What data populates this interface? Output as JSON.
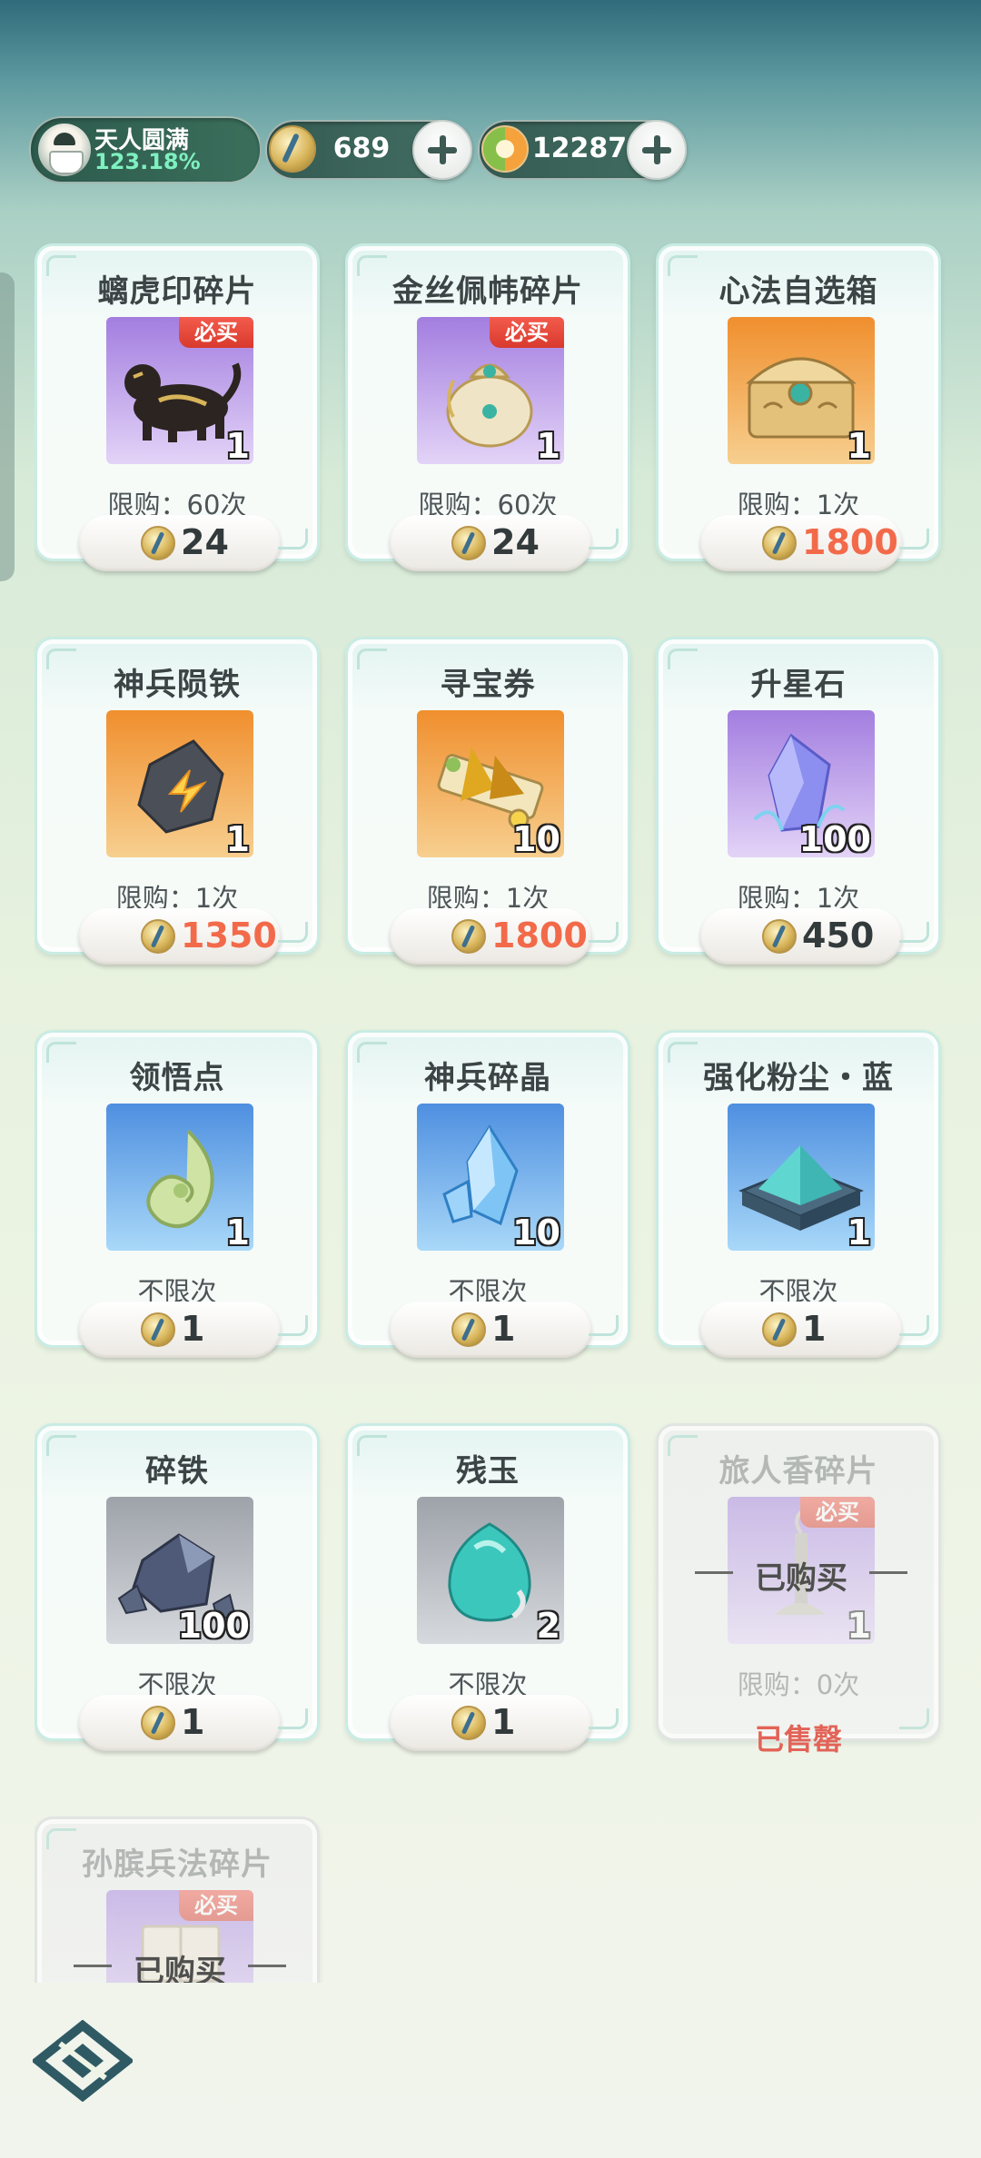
{
  "header": {
    "realm_title": "天人圆满",
    "realm_value": "123.18%",
    "currency_1_amount": "689",
    "currency_2_amount": "12287"
  },
  "shop": {
    "items": [
      {
        "name": "螭虎印碎片",
        "count": "1",
        "badge": "必买",
        "limit": "限购：60次",
        "price": "24",
        "bg": "purple",
        "icon": "tiger-icon"
      },
      {
        "name": "金丝佩帏碎片",
        "count": "1",
        "badge": "必买",
        "limit": "限购：60次",
        "price": "24",
        "bg": "purple",
        "icon": "pouch-icon"
      },
      {
        "name": "心法自选箱",
        "count": "1",
        "badge": "",
        "limit": "限购：1次",
        "price": "1800",
        "bg": "orange",
        "icon": "chest-icon",
        "highlight": true
      },
      {
        "name": "神兵陨铁",
        "count": "1",
        "badge": "",
        "limit": "限购：1次",
        "price": "1350",
        "bg": "orange",
        "icon": "meteorite-icon",
        "highlight": true
      },
      {
        "name": "寻宝券",
        "count": "10",
        "badge": "",
        "limit": "限购：1次",
        "price": "1800",
        "bg": "orange",
        "icon": "scroll-icon",
        "highlight": true
      },
      {
        "name": "升星石",
        "count": "100",
        "badge": "",
        "limit": "限购：1次",
        "price": "450",
        "bg": "purple",
        "icon": "crystal-icon"
      },
      {
        "name": "领悟点",
        "count": "1",
        "badge": "",
        "limit": "不限次",
        "price": "1",
        "bg": "blue",
        "icon": "jade-swirl-icon"
      },
      {
        "name": "神兵碎晶",
        "count": "10",
        "badge": "",
        "limit": "不限次",
        "price": "1",
        "bg": "blue",
        "icon": "shard-icon"
      },
      {
        "name": "强化粉尘・蓝",
        "count": "1",
        "badge": "",
        "limit": "不限次",
        "price": "1",
        "bg": "blue",
        "icon": "dust-icon"
      },
      {
        "name": "碎铁",
        "count": "100",
        "badge": "",
        "limit": "不限次",
        "price": "1",
        "bg": "gray",
        "icon": "ore-icon"
      },
      {
        "name": "残玉",
        "count": "2",
        "badge": "",
        "limit": "不限次",
        "price": "1",
        "bg": "gray",
        "icon": "jade-stone-icon"
      },
      {
        "name": "旅人香碎片",
        "count": "1",
        "badge": "必买",
        "limit": "限购：0次",
        "purchased": "已购买",
        "soldout": "已售罄",
        "bg": "purple",
        "icon": "incense-icon"
      },
      {
        "name": "孙膑兵法碎片",
        "count": "",
        "badge": "必买",
        "limit": "",
        "purchased": "已购买",
        "bg": "purple",
        "icon": "book-icon"
      }
    ]
  },
  "colors": {
    "price_highlight": "#f26a4a",
    "badge_red": "#e04a3e"
  }
}
